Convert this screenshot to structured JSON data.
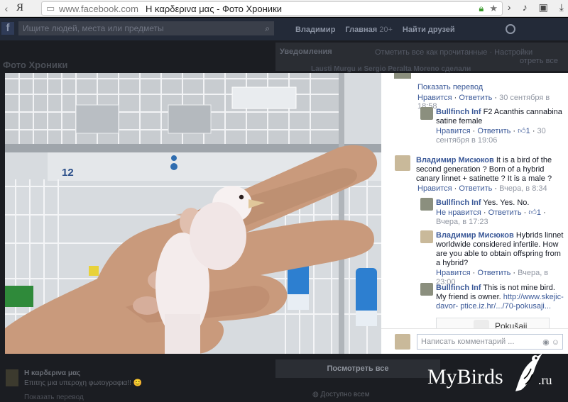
{
  "browser": {
    "y_logo": "Я",
    "url_domain": "www.facebook.com",
    "tab_title": "Η καρδερινα μας - Фото Хроники"
  },
  "fb": {
    "search_placeholder": "Ищите людей, места или предметы",
    "nav_user": "Владимир",
    "nav_home": "Главная",
    "nav_home_count": "20+",
    "nav_friends": "Найти друзей",
    "photos_title": "Фото Хроники",
    "notif_title": "Уведомления",
    "notif_links": "Отметить все как прочитанные · Настройки",
    "notif_user": "Lausti Murgu и Sergio Peralta Moreno сделали",
    "notif_right": "отреть все"
  },
  "comments": {
    "top_translate": "Показать перевод",
    "top_like": "Нравится",
    "top_reply": "Ответить",
    "top_date": "30 сентября в 18:58",
    "c1_name": "Bullfinch Inf",
    "c1_text": "F2 Acanthis cannabina satine female",
    "c1_like": "Нравится",
    "c1_reply": "Ответить",
    "c1_likes": "1",
    "c1_date_a": "30",
    "c1_date_b": "сентября в 19:06",
    "c2_name": "Владимир Мисюков",
    "c2_text_a": "It is a bird of the second",
    "c2_text_b": "generation ? Born of a hybrid canary linnet +",
    "c2_text_c": "satinette ? It is a male ?",
    "c2_like": "Нравится",
    "c2_reply": "Ответить",
    "c2_date": "Вчера, в 8:34",
    "c3_name": "Bullfinch Inf",
    "c3_text": "Yes. Yes. No.",
    "c3_like": "Не нравится",
    "c3_reply": "Ответить",
    "c3_likes": "1",
    "c3_date_a": "Вчера,",
    "c3_date_b": "в 17:23",
    "c4_name": "Владимир Мисюков",
    "c4_text_a": "Hybrids linnet",
    "c4_text_b": "worldwide considered infertile. How are",
    "c4_text_c": "you able to obtain offspring from a",
    "c4_text_d": "hybrid?",
    "c4_like": "Нравится",
    "c4_reply": "Ответить",
    "c4_date": "Вчера, в 23:00",
    "c5_name": "Bullfinch Inf",
    "c5_text_a": "This is not mine bird. My",
    "c5_text_b": "friend is owner.",
    "c5_link_a": "http://www.skejic-davor-",
    "c5_link_b": "ptice.iz.hr/.../70-pokusaji...",
    "preview_title": "Pokušaji",
    "compose_placeholder": "Написать комментарий ..."
  },
  "lower": {
    "cap_title": "Η καρδερινα μας",
    "cap_sub": "Επιτης μια υπεροχη φωτογραφια!! 😊",
    "cap_trans": "Показать перевод",
    "see_all": "Посмотреть все",
    "access": "Доступно всем"
  },
  "cage_number": "12",
  "watermark": {
    "brand": "MyBirds",
    "tld": ".ru"
  },
  "colors": {
    "fb_blue": "#3b5998",
    "meta_gray": "#9197a3",
    "secure_green": "#3b9a2d"
  }
}
